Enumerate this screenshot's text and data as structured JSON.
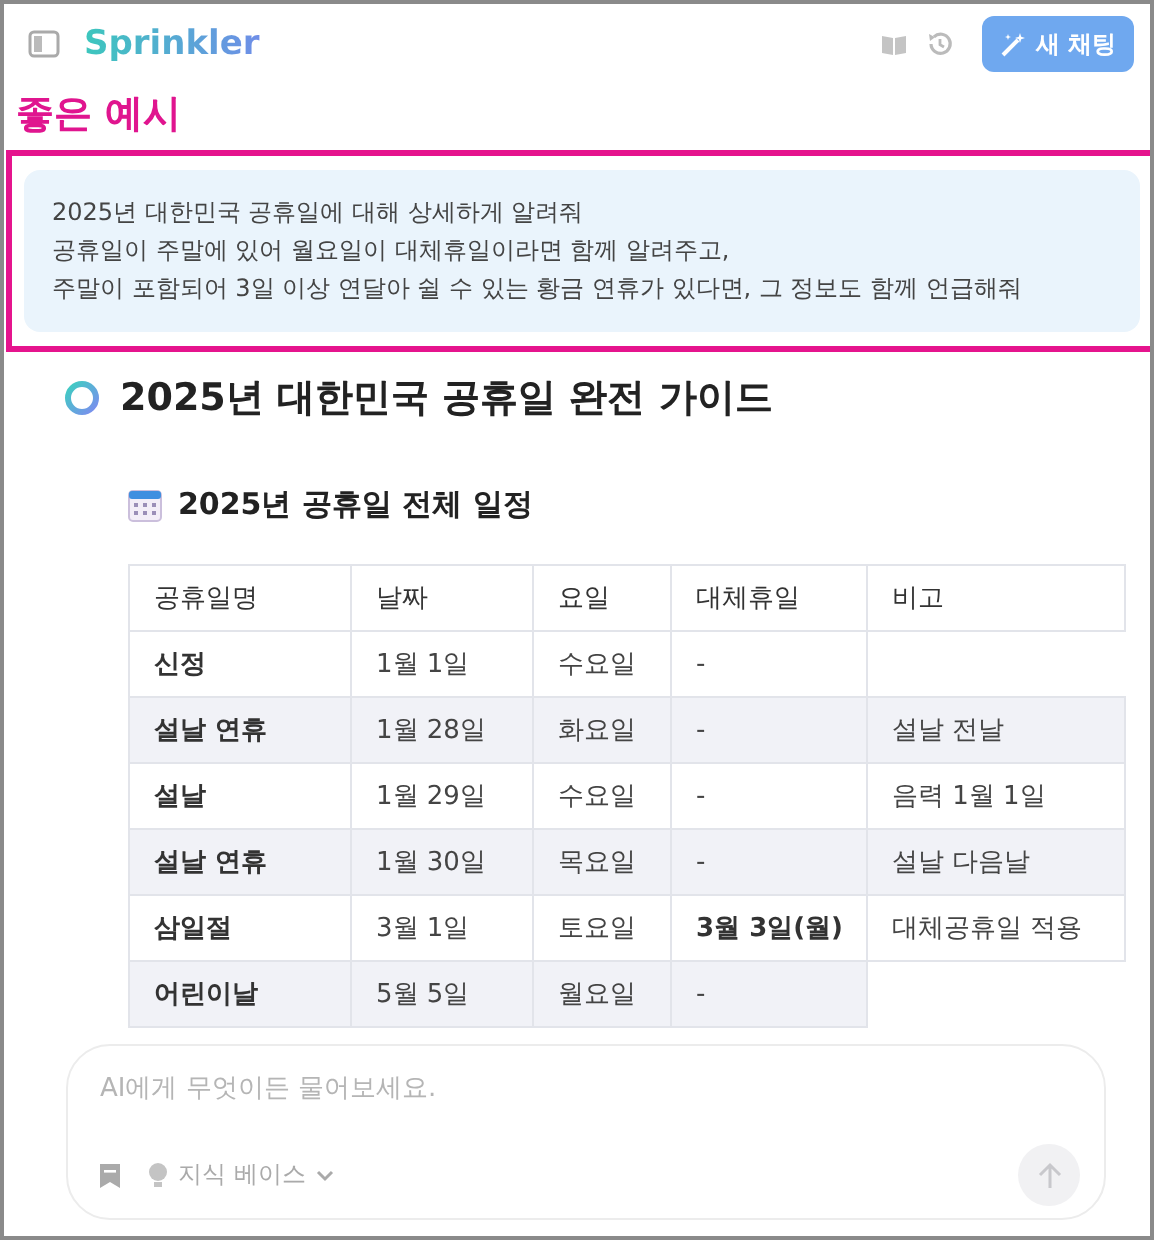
{
  "header": {
    "brand": "Sprinkler",
    "new_chat_button": "새 채팅"
  },
  "annotation": {
    "label": "좋은 예시",
    "prompt_lines": [
      "2025년 대한민국 공휴일에 대해 상세하게 알려줘",
      "공휴일이 주말에 있어 월요일이 대체휴일이라면 함께 알려주고,",
      "주말이 포함되어 3일 이상 연달아 쉴 수 있는 황금 연휴가 있다면, 그 정보도 함께 언급해줘"
    ]
  },
  "answer": {
    "title": "2025년 대한민국 공휴일 완전 가이드",
    "section_title": "2025년 공휴일 전체 일정",
    "table": {
      "columns": [
        "공휴일명",
        "날짜",
        "요일",
        "대체휴일",
        "비고"
      ],
      "rows": [
        {
          "cells": [
            {
              "text": "신정",
              "bold": true
            },
            {
              "text": "1월 1일",
              "bold": false
            },
            {
              "text": "수요일",
              "bold": false
            },
            {
              "text": "-",
              "bold": false
            }
          ]
        },
        {
          "cells": [
            {
              "text": "설날 연휴",
              "bold": true
            },
            {
              "text": "1월 28일",
              "bold": false
            },
            {
              "text": "화요일",
              "bold": false
            },
            {
              "text": "-",
              "bold": false
            },
            {
              "text": "설날 전날",
              "bold": false
            }
          ]
        },
        {
          "cells": [
            {
              "text": "설날",
              "bold": true
            },
            {
              "text": "1월 29일",
              "bold": false
            },
            {
              "text": "수요일",
              "bold": false
            },
            {
              "text": "-",
              "bold": false
            },
            {
              "text": "음력 1월 1일",
              "bold": false
            }
          ]
        },
        {
          "cells": [
            {
              "text": "설날 연휴",
              "bold": true
            },
            {
              "text": "1월 30일",
              "bold": false
            },
            {
              "text": "목요일",
              "bold": false
            },
            {
              "text": "-",
              "bold": false
            },
            {
              "text": "설날 다음날",
              "bold": false
            }
          ]
        },
        {
          "cells": [
            {
              "text": "삼일절",
              "bold": true
            },
            {
              "text": "3월 1일",
              "bold": false
            },
            {
              "text": "토요일",
              "bold": false
            },
            {
              "text": "3월 3일(월)",
              "bold": true
            },
            {
              "text": "대체공휴일 적용",
              "bold": false
            }
          ]
        },
        {
          "cells": [
            {
              "text": "어린이날",
              "bold": true
            },
            {
              "text": "5월 5일",
              "bold": false
            },
            {
              "text": "월요일",
              "bold": false
            },
            {
              "text": "-",
              "bold": false
            }
          ]
        }
      ]
    }
  },
  "composer": {
    "placeholder": "AI에게 무엇이든 물어보세요.",
    "knowledge_button": "지식 베이스"
  }
}
